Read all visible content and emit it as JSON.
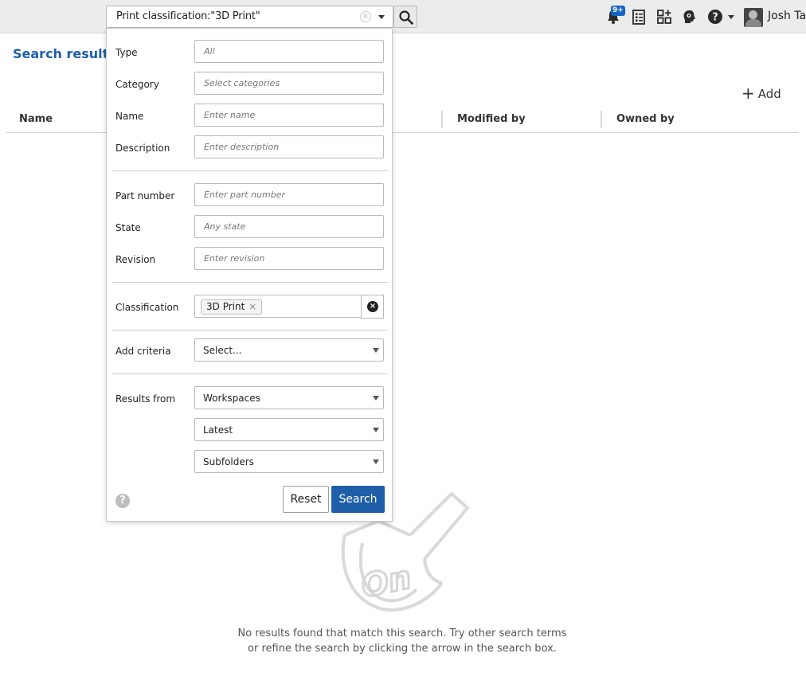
{
  "topbar": {
    "search_query": "Print classification:\"3D Print\"",
    "notification_badge": "9+",
    "user_name": "Josh Ta"
  },
  "page": {
    "title": "Search results i",
    "add_label": "Add",
    "columns": [
      "Name",
      "Modified by",
      "Owned by"
    ],
    "empty_message_line1": "No results found that match this search. Try other search terms",
    "empty_message_line2": "or refine the search by clicking the arrow in the search box."
  },
  "filter_panel": {
    "type_label": "Type",
    "type_placeholder": "All",
    "category_label": "Category",
    "category_placeholder": "Select categories",
    "name_label": "Name",
    "name_placeholder": "Enter name",
    "description_label": "Description",
    "description_placeholder": "Enter description",
    "part_number_label": "Part number",
    "part_number_placeholder": "Enter part number",
    "state_label": "State",
    "state_placeholder": "Any state",
    "revision_label": "Revision",
    "revision_placeholder": "Enter revision",
    "classification_label": "Classification",
    "classification_chip": "3D Print",
    "add_criteria_label": "Add criteria",
    "add_criteria_value": "Select...",
    "results_from_label": "Results from",
    "results_from_value": "Workspaces",
    "version_value": "Latest",
    "scope_value": "Subfolders",
    "reset_label": "Reset",
    "search_label": "Search"
  },
  "colors": {
    "accent": "#1f5ea8",
    "topbar_bg": "#ececec",
    "badge_bg": "#1565c0"
  }
}
